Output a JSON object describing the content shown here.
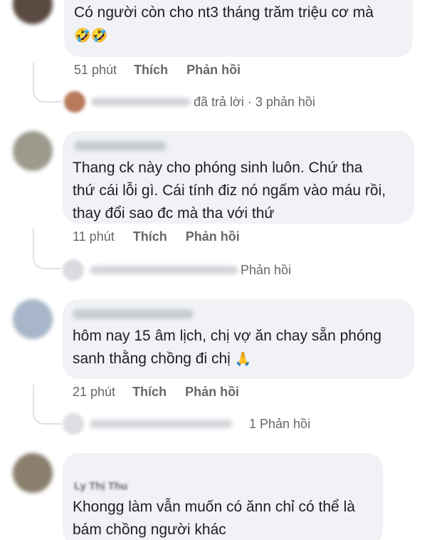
{
  "comments": [
    {
      "text_lines": [
        "Có người còn cho nt3 tháng trăm triệu cơ mà"
      ],
      "emoji": "🤣🤣",
      "time": "51 phút",
      "like": "Thích",
      "reply": "Phản hồi",
      "reply_summary": "đã trả lời · 3 phản hồi"
    },
    {
      "text_lines": [
        "Thang ck này cho phóng sinh luôn. Chứ tha",
        "thứ cái lỗi gì. Cái tính điz nó ngấm vào máu rồi,",
        "thay đổi sao đc mà tha với thứ"
      ],
      "time": "11 phút",
      "like": "Thích",
      "reply": "Phản hồi",
      "reply_summary": "Phản hồi"
    },
    {
      "text_lines": [
        "hôm nay 15 âm lịch, chị vợ ăn chay sẵn phóng",
        "sanh thằng chồng đi chị"
      ],
      "emoji": "🙏",
      "time": "21 phút",
      "like": "Thích",
      "reply": "Phản hồi",
      "reply_summary": "1 Phản hồi"
    },
    {
      "name": "Ly Thị Thu",
      "text_lines": [
        "Khongg làm vẫn muốn có ănn chỉ có thể là",
        "bám chồng người khác"
      ]
    }
  ]
}
